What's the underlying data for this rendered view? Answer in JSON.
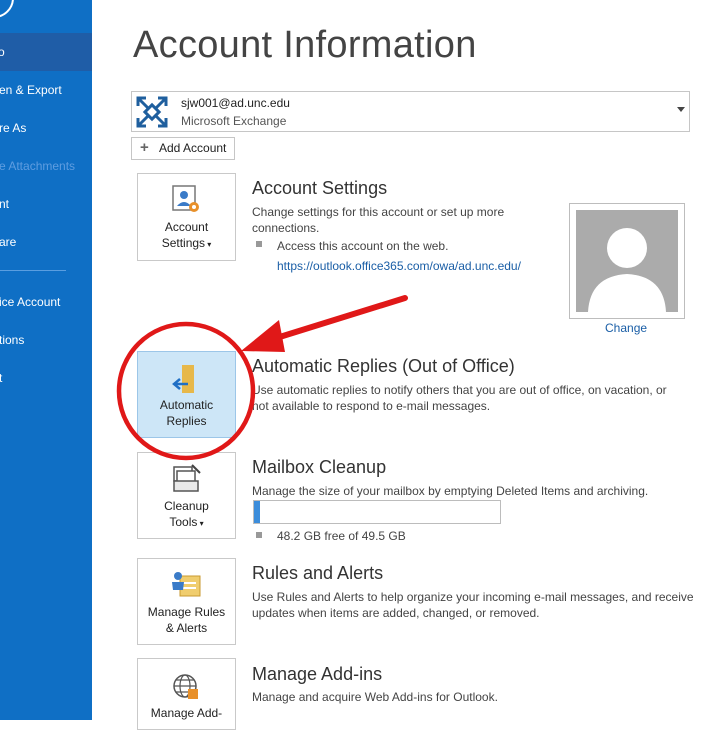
{
  "nav": {
    "items": [
      {
        "label": "o",
        "active": true
      },
      {
        "label": "en & Export"
      },
      {
        "label": "re As"
      },
      {
        "label": "e Attachments",
        "disabled": true
      },
      {
        "label": "nt"
      },
      {
        "label": "are"
      },
      {
        "label": "ice Account"
      },
      {
        "label": "tions"
      },
      {
        "label": "t"
      }
    ]
  },
  "page": {
    "title": "Account Information"
  },
  "account": {
    "email": "sjw001@ad.unc.edu",
    "type": "Microsoft Exchange"
  },
  "add_account": {
    "label": "Add Account"
  },
  "account_settings": {
    "tile_line1": "Account",
    "tile_line2": "Settings",
    "title": "Account Settings",
    "desc_line1": "Change settings for this account or set up more",
    "desc_line2": "connections.",
    "bullet_text": "Access this account on the web.",
    "link": "https://outlook.office365.com/owa/ad.unc.edu/"
  },
  "profile": {
    "change_label": "Change"
  },
  "automatic_replies": {
    "tile_line1": "Automatic",
    "tile_line2": "Replies",
    "title": "Automatic Replies (Out of Office)",
    "desc_line1": "Use automatic replies to notify others that you are out of office, on vacation, or",
    "desc_line2": "not available to respond to e-mail messages."
  },
  "mailbox_cleanup": {
    "tile_line1": "Cleanup",
    "tile_line2": "Tools",
    "title": "Mailbox Cleanup",
    "desc": "Manage the size of your mailbox by emptying Deleted Items and archiving.",
    "quota_text": "48.2 GB free of 49.5 GB",
    "used_fraction": 0.026
  },
  "rules_alerts": {
    "tile_line1": "Manage Rules",
    "tile_line2": "& Alerts",
    "title": "Rules and Alerts",
    "desc_line1": "Use Rules and Alerts to help organize your incoming e-mail messages, and receive",
    "desc_line2": "updates when items are added, changed, or removed."
  },
  "addins": {
    "tile_line1": "Manage Add-",
    "title": "Manage Add-ins",
    "desc": "Manage and acquire Web Add-ins for Outlook."
  },
  "colors": {
    "nav_bg": "#0f6fc5",
    "nav_active": "#1f5da7",
    "highlight_tile": "#cde6f7",
    "annotation_red": "#e01818",
    "link": "#1a5ea6"
  }
}
